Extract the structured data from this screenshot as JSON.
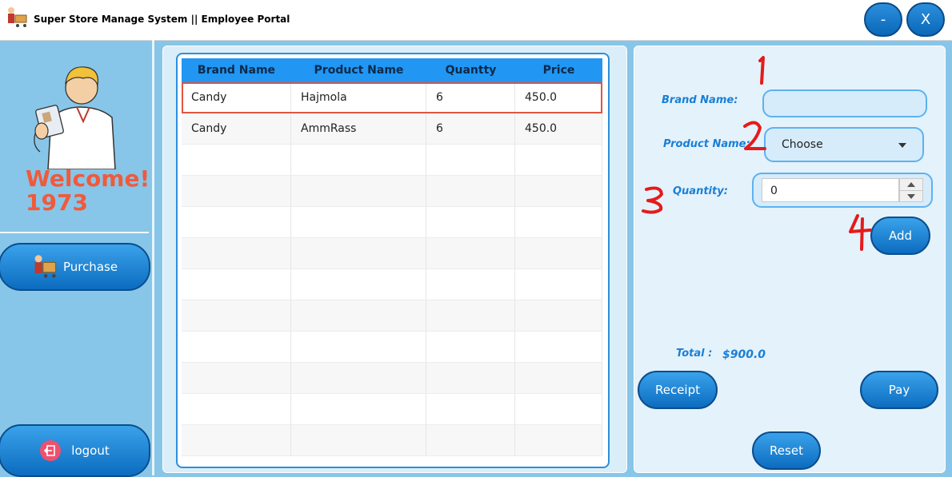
{
  "window": {
    "title": "Super Store Manage System || Employee Portal",
    "minimize_label": "-",
    "close_label": "X"
  },
  "sidebar": {
    "welcome_text": "Welcome!",
    "user_id": "1973",
    "purchase_label": "Purchase",
    "logout_label": "logout"
  },
  "table": {
    "columns": [
      "Brand Name",
      "Product  Name",
      "Quantty",
      "Price"
    ],
    "rows": [
      [
        "Candy",
        "Hajmola",
        "6",
        "450.0"
      ],
      [
        "Candy",
        "AmmRass",
        "6",
        "450.0"
      ]
    ]
  },
  "form": {
    "brand_label": "Brand Name:",
    "brand_value": "",
    "product_label": "Product Name:",
    "product_selected": "Choose",
    "quantity_label": "Quantity:",
    "quantity_value": "0",
    "add_label": "Add",
    "total_label": "Total :",
    "total_value": "$900.0",
    "receipt_label": "Receipt",
    "pay_label": "Pay",
    "reset_label": "Reset"
  },
  "annotations": [
    "1",
    "2",
    "3",
    "4"
  ],
  "colors": {
    "background": "#87c6e8",
    "accent": "#2196f3",
    "welcome": "#f05a3c",
    "highlight": "#e2553f"
  }
}
